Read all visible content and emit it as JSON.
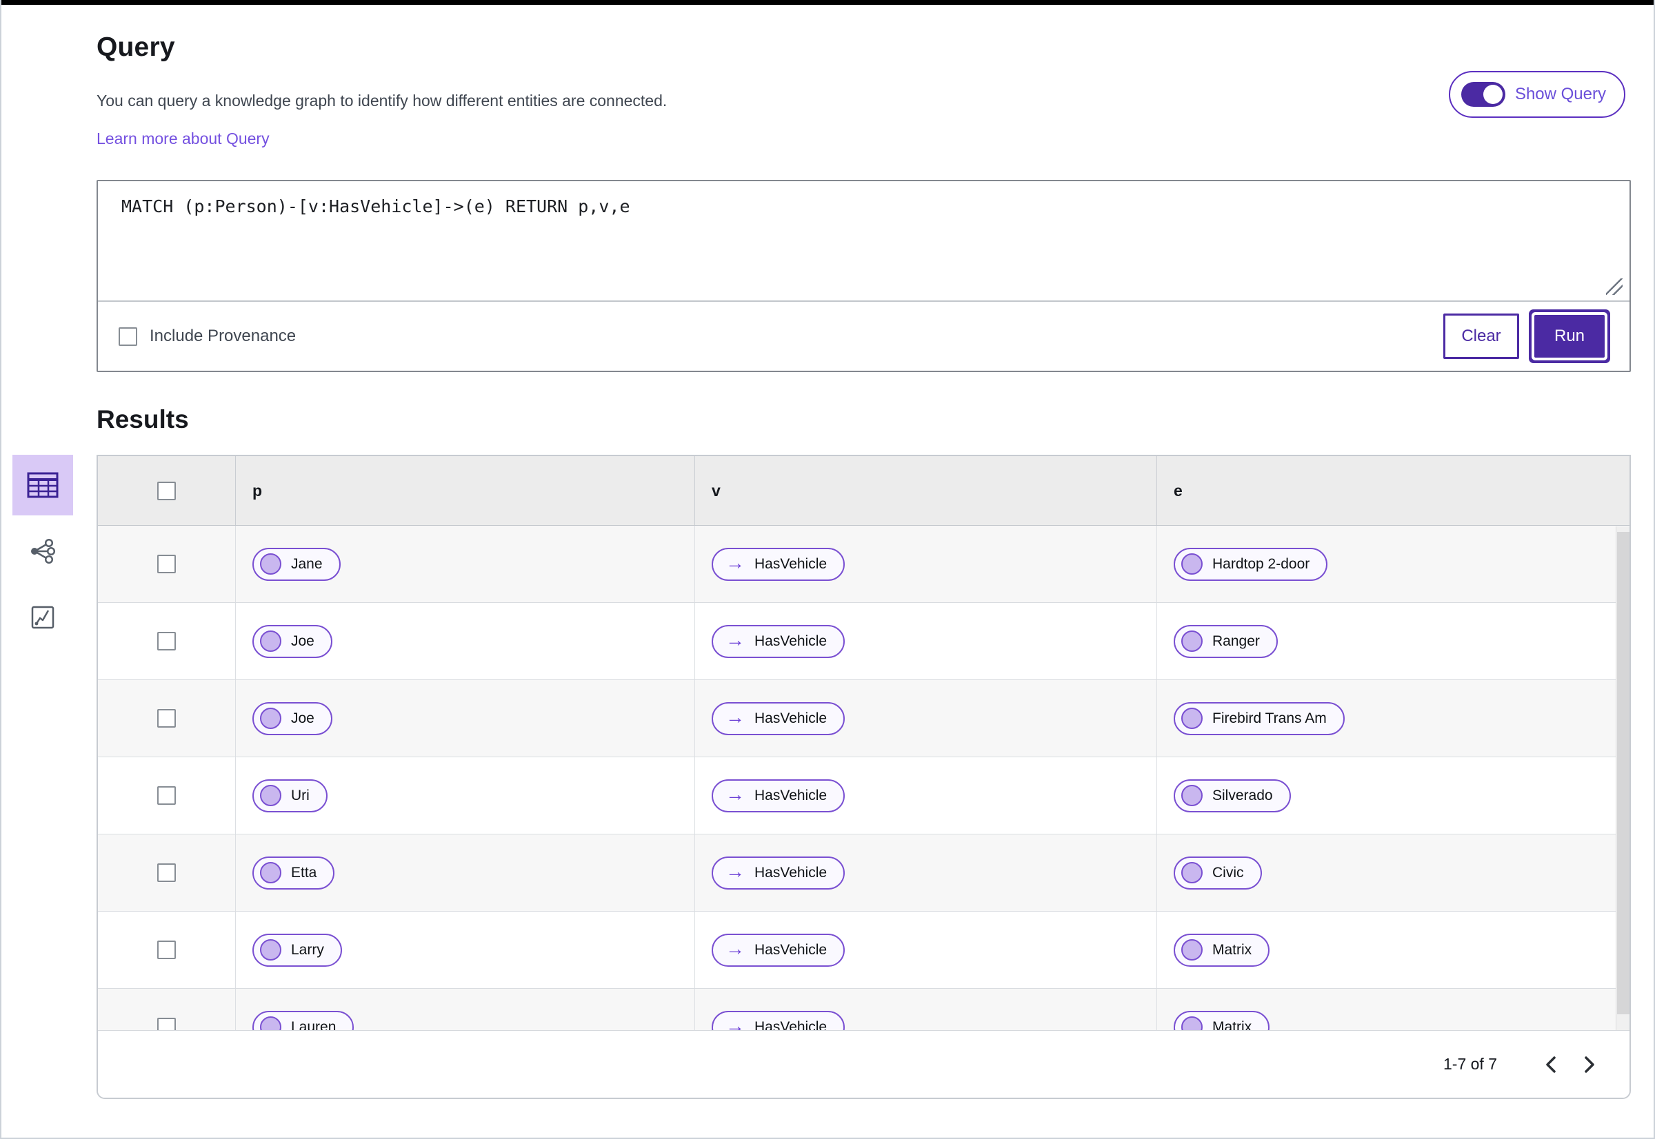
{
  "header": {
    "title": "Query",
    "description": "You can query a knowledge graph to identify how different entities are connected.",
    "learn_more_link": "Learn more about Query",
    "show_query_toggle": {
      "label": "Show Query",
      "state": "on"
    }
  },
  "query_editor": {
    "query_text": "MATCH (p:Person)-[v:HasVehicle]->(e) RETURN p,v,e",
    "include_provenance": {
      "label": "Include Provenance",
      "checked": false
    },
    "buttons": {
      "clear": "Clear",
      "run": "Run"
    }
  },
  "results": {
    "title": "Results",
    "view_switcher": [
      {
        "name": "table-view",
        "selected": true
      },
      {
        "name": "graph-view",
        "selected": false
      },
      {
        "name": "expand-view",
        "selected": false
      }
    ],
    "table": {
      "columns": [
        "p",
        "v",
        "e"
      ],
      "rows": [
        {
          "p": "Jane",
          "v": "HasVehicle",
          "e": "Hardtop 2-door"
        },
        {
          "p": "Joe",
          "v": "HasVehicle",
          "e": "Ranger"
        },
        {
          "p": "Joe",
          "v": "HasVehicle",
          "e": "Firebird Trans Am"
        },
        {
          "p": "Uri",
          "v": "HasVehicle",
          "e": "Silverado"
        },
        {
          "p": "Etta",
          "v": "HasVehicle",
          "e": "Civic"
        },
        {
          "p": "Larry",
          "v": "HasVehicle",
          "e": "Matrix"
        },
        {
          "p": "Lauren",
          "v": "HasVehicle",
          "e": "Matrix"
        }
      ]
    },
    "pagination": {
      "range_label": "1-7 of 7"
    }
  },
  "colors": {
    "primary_purple": "#4b2aa3",
    "pill_border": "#7a50d2",
    "pill_dot_fill": "#c9b7ef",
    "link_purple": "#7450e0",
    "selected_view_bg": "#d9c9f6",
    "table_header_bg": "#ececec",
    "alt_row_bg": "#f7f7f7"
  }
}
